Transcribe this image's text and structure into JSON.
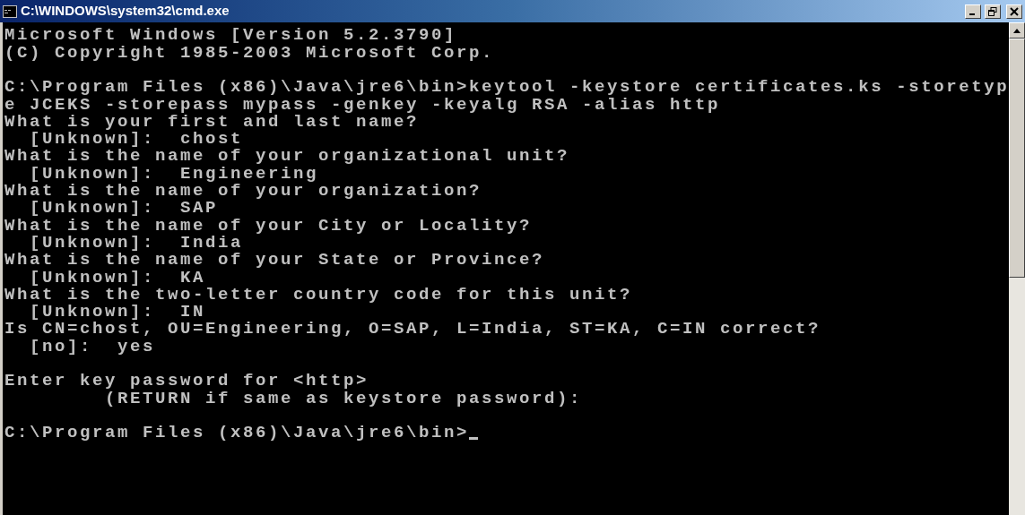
{
  "window": {
    "title": "C:\\WINDOWS\\system32\\cmd.exe"
  },
  "lines": [
    {
      "kind": "text",
      "text": "Microsoft Windows [Version 5.2.3790]"
    },
    {
      "kind": "text",
      "text": "(C) Copyright 1985-2003 Microsoft Corp."
    },
    {
      "kind": "blank"
    },
    {
      "kind": "text",
      "text": "C:\\Program Files (x86)\\Java\\jre6\\bin>keytool -keystore certificates.ks -storetyp"
    },
    {
      "kind": "text",
      "text": "e JCEKS -storepass mypass -genkey -keyalg RSA -alias http"
    },
    {
      "kind": "text",
      "text": "What is your first and last name?"
    },
    {
      "kind": "text",
      "text": "  [Unknown]:  chost"
    },
    {
      "kind": "text",
      "text": "What is the name of your organizational unit?"
    },
    {
      "kind": "text",
      "text": "  [Unknown]:  Engineering"
    },
    {
      "kind": "text",
      "text": "What is the name of your organization?"
    },
    {
      "kind": "text",
      "text": "  [Unknown]:  SAP"
    },
    {
      "kind": "text",
      "text": "What is the name of your City or Locality?"
    },
    {
      "kind": "text",
      "text": "  [Unknown]:  India"
    },
    {
      "kind": "text",
      "text": "What is the name of your State or Province?"
    },
    {
      "kind": "text",
      "text": "  [Unknown]:  KA"
    },
    {
      "kind": "text",
      "text": "What is the two-letter country code for this unit?"
    },
    {
      "kind": "text",
      "text": "  [Unknown]:  IN"
    },
    {
      "kind": "text",
      "text": "Is CN=chost, OU=Engineering, O=SAP, L=India, ST=KA, C=IN correct?"
    },
    {
      "kind": "text",
      "text": "  [no]:  yes"
    },
    {
      "kind": "blank"
    },
    {
      "kind": "text",
      "text": "Enter key password for <http>"
    },
    {
      "kind": "text",
      "text": "        (RETURN if same as keystore password):"
    },
    {
      "kind": "blank"
    },
    {
      "kind": "prompt",
      "text": "C:\\Program Files (x86)\\Java\\jre6\\bin>"
    }
  ]
}
